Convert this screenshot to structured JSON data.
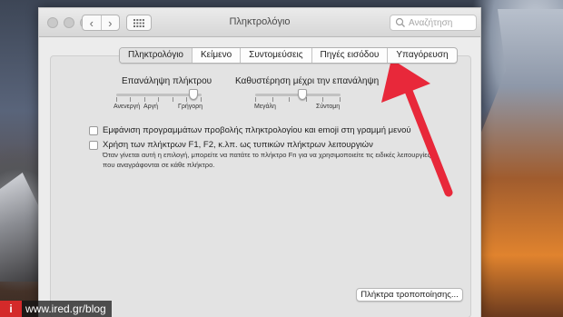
{
  "window": {
    "title": "Πληκτρολόγιο",
    "search_placeholder": "Αναζήτηση",
    "nav_back": "‹",
    "nav_forward": "›"
  },
  "tabs": [
    {
      "label": "Πληκτρολόγιο",
      "active": true
    },
    {
      "label": "Κείμενο",
      "active": false
    },
    {
      "label": "Συντομεύσεις",
      "active": false
    },
    {
      "label": "Πηγές εισόδου",
      "active": false
    },
    {
      "label": "Υπαγόρευση",
      "active": false
    }
  ],
  "key_repeat": {
    "label": "Επανάληψη πλήκτρου",
    "left_labels": [
      "Ανενεργή",
      "Αργή"
    ],
    "right_label": "Γρήγορη",
    "value": 0.9
  },
  "delay_until_repeat": {
    "label": "Καθυστέρηση μέχρι την επανάληψη",
    "left_label": "Μεγάλη",
    "right_label": "Σύντομη",
    "value": 0.55
  },
  "options": [
    {
      "label": "Εμφάνιση προγραμμάτων προβολής πληκτρολογίου και emoji στη γραμμή μενού",
      "checked": false
    },
    {
      "label": "Χρήση των πλήκτρων F1, F2, κ.λπ. ως τυπικών πλήκτρων λειτουργιών",
      "checked": false
    }
  ],
  "fn_description": "Όταν γίνεται αυτή η επιλογή, μπορείτε να πατάτε το πλήκτρο Fn για να χρησιμοποιείτε τις ειδικές λειτουργίες που αναγράφονται σε κάθε πλήκτρο.",
  "modifier_button": "Πλήκτρα τροποποίησης...",
  "watermark": {
    "logo": "i",
    "text": "www.ired.gr/blog"
  },
  "colors": {
    "arrow": "#e8283a",
    "watermark_logo": "#d42a2a"
  }
}
